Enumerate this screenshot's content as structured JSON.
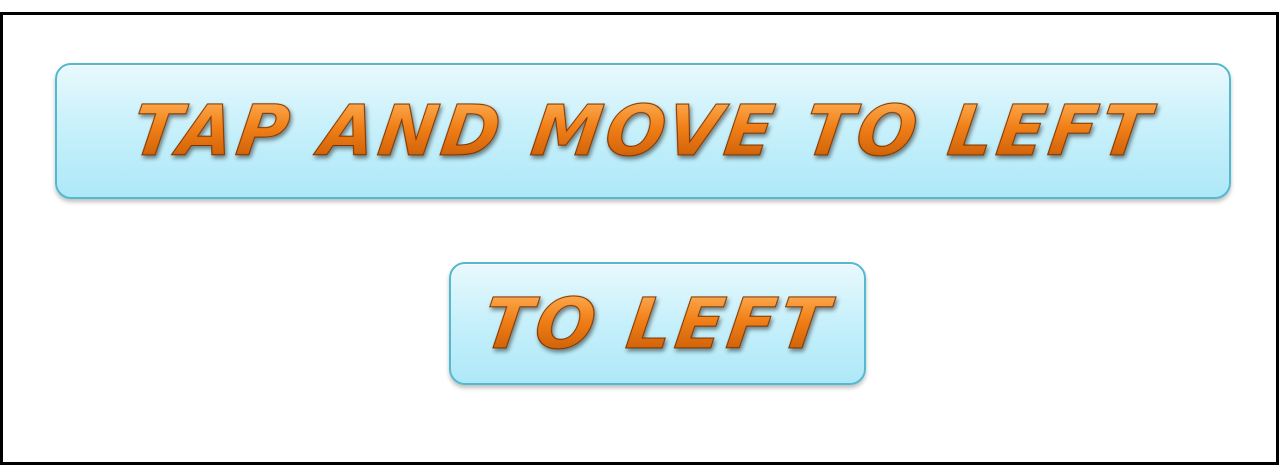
{
  "buttons": {
    "primary": {
      "label": "TAP AND MOVE TO LEFT"
    },
    "secondary": {
      "label": "TO LEFT"
    }
  },
  "colors": {
    "text_orange": "#f07f17",
    "button_fill": "#c6f0fb",
    "button_border": "#52b9cf",
    "frame_border": "#000000"
  }
}
